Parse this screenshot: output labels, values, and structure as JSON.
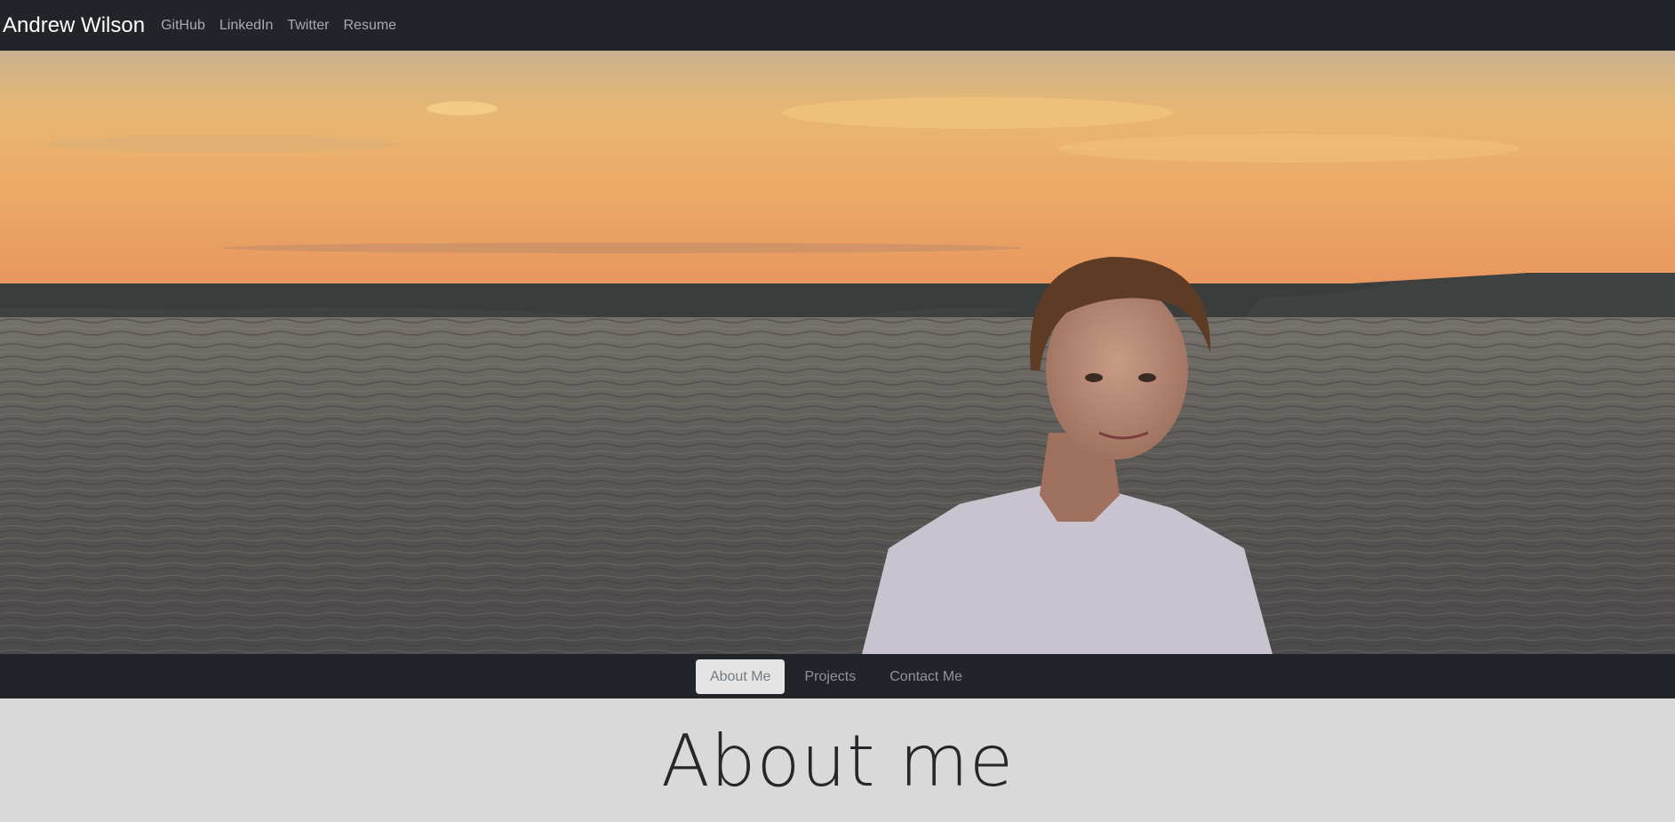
{
  "navbar": {
    "brand": "Andrew Wilson",
    "links": [
      "GitHub",
      "LinkedIn",
      "Twitter",
      "Resume"
    ]
  },
  "hero": {
    "image": "portrait-lake-sunset-photo"
  },
  "section_nav": {
    "tabs": [
      "About Me",
      "Projects",
      "Contact Me"
    ],
    "active": "About Me"
  },
  "about": {
    "heading": "About me"
  },
  "colors": {
    "navbar_bg": "#212529",
    "page_bg": "#d9d9d9",
    "active_pill_bg": "#e4e4e4"
  }
}
